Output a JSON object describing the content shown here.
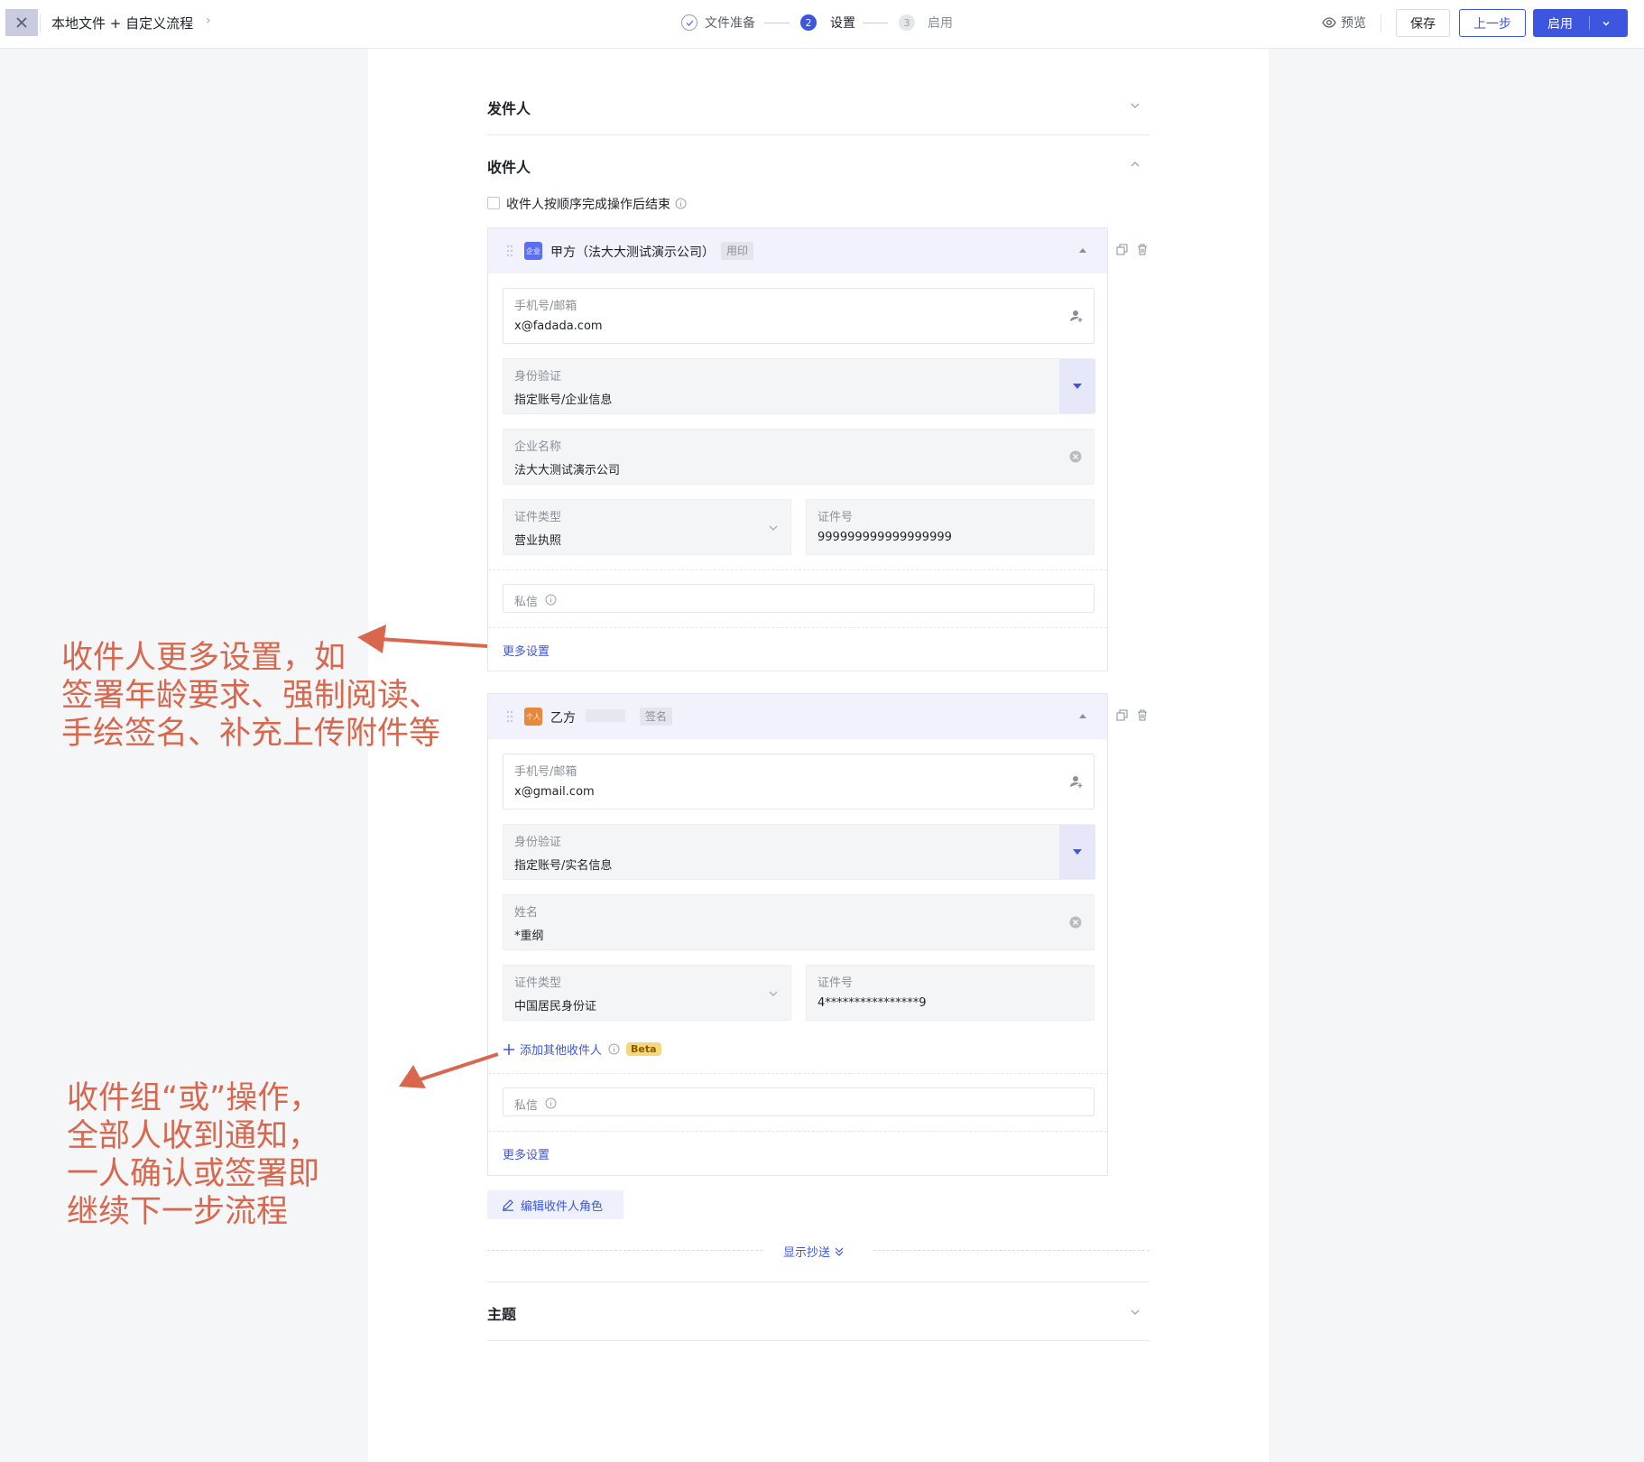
{
  "topbar": {
    "title": "本地文件 + 自定义流程",
    "steps": [
      {
        "num": "",
        "label": "文件准备",
        "state": "done"
      },
      {
        "num": "2",
        "label": "设置",
        "state": "active"
      },
      {
        "num": "3",
        "label": "启用",
        "state": "todo"
      }
    ],
    "preview_label": "预览",
    "save_label": "保存",
    "prev_label": "上一步",
    "enable_label": "启用"
  },
  "sender": {
    "title": "发件人"
  },
  "recipients": {
    "title": "收件人",
    "sequential_label": "收件人按顺序完成操作后结束",
    "cards": [
      {
        "type_badge": "企业",
        "name": "甲方（法大大测试演示公司）",
        "action_tag": "用印",
        "contact_label": "手机号/邮箱",
        "contact_value": "x@fadada.com",
        "verify_label": "身份验证",
        "verify_value": "指定账号/企业信息",
        "name_field_label": "企业名称",
        "name_field_value": "法大大测试演示公司",
        "id_type_label": "证件类型",
        "id_type_value": "营业执照",
        "id_no_label": "证件号",
        "id_no_value": "999999999999999999",
        "message_label": "私信",
        "more_settings": "更多设置"
      },
      {
        "type_badge": "个人",
        "name": "乙方",
        "action_tag": "签名",
        "contact_label": "手机号/邮箱",
        "contact_value": "x@gmail.com",
        "verify_label": "身份验证",
        "verify_value": "指定账号/实名信息",
        "name_field_label": "姓名",
        "name_field_value": "*重纲",
        "id_type_label": "证件类型",
        "id_type_value": "中国居民身份证",
        "id_no_label": "证件号",
        "id_no_value": "4****************9",
        "add_other_label": "添加其他收件人",
        "beta_label": "Beta",
        "message_label": "私信",
        "more_settings": "更多设置"
      }
    ],
    "edit_roles_label": "编辑收件人角色",
    "show_cc_label": "显示抄送"
  },
  "subject": {
    "title": "主题"
  },
  "annotations": {
    "more_settings_note": [
      "收件人更多设置，如",
      "签署年龄要求、强制阅读、",
      "手绘签名、补充上传附件等"
    ],
    "or_group_note": [
      "收件组“或”操作，",
      "全部人收到通知，",
      "一人确认或签署即",
      "继续下一步流程"
    ]
  },
  "colors": {
    "accent": "#3d56e0",
    "annotation": "#d9674e",
    "org_badge": "#5b6ef5",
    "person_badge": "#e8883a"
  }
}
